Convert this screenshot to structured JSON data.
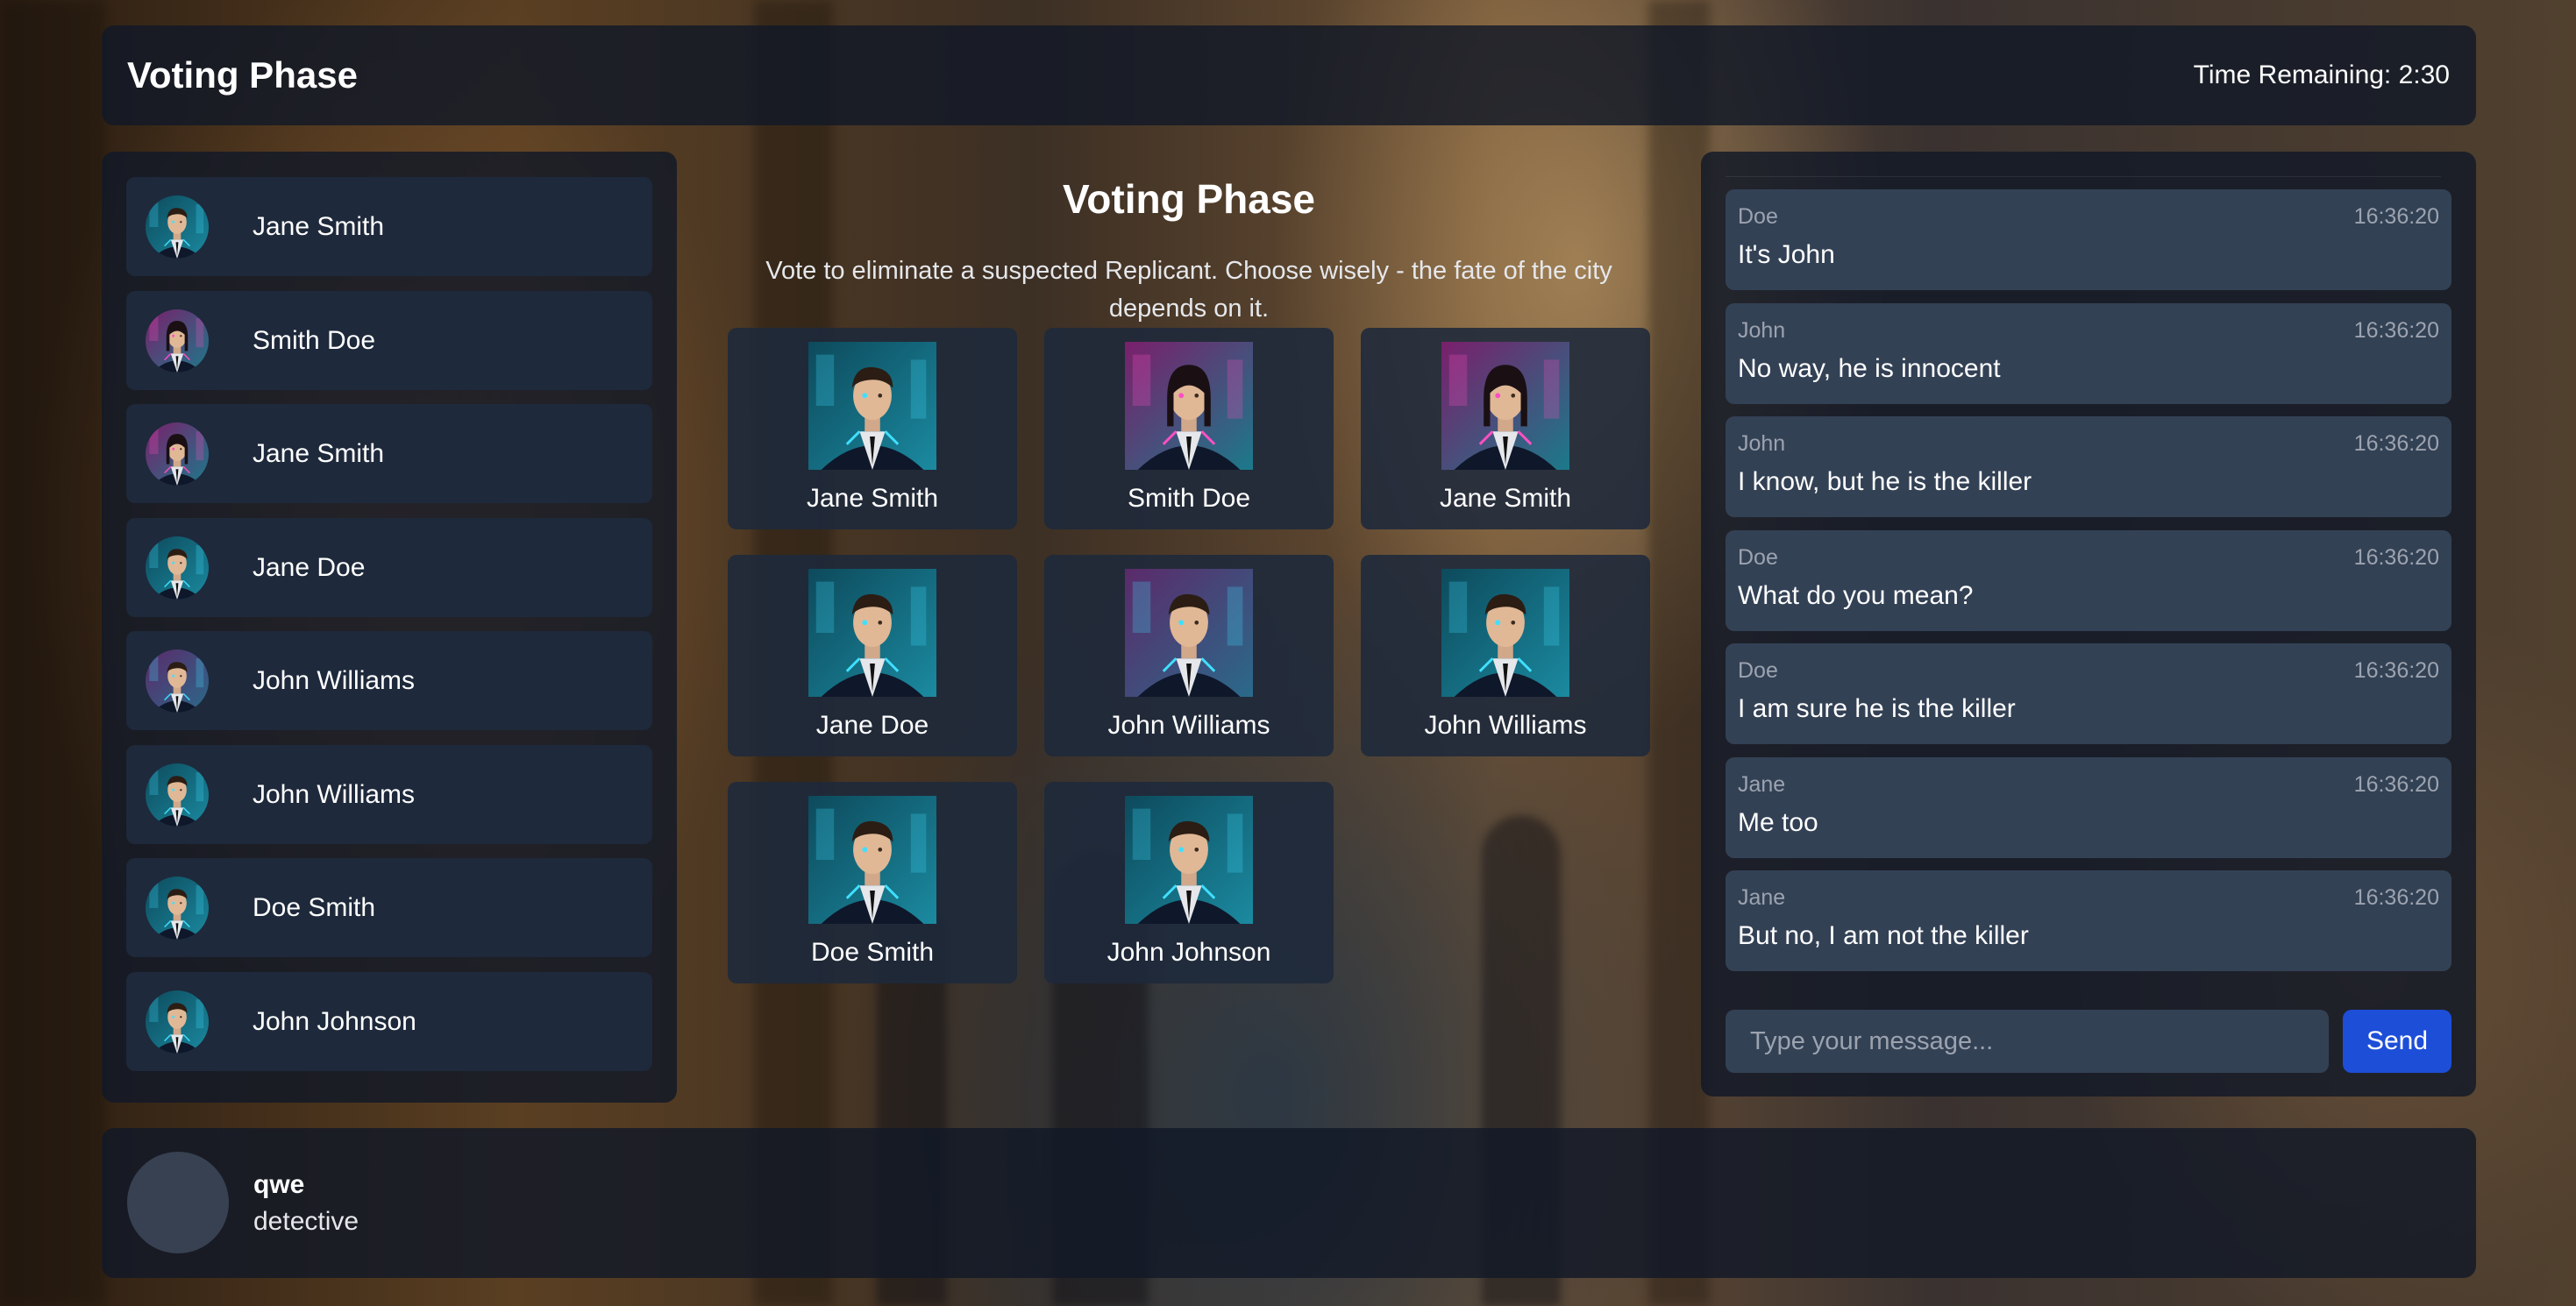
{
  "header": {
    "title": "Voting Phase",
    "timer": "Time Remaining: 2:30"
  },
  "players": [
    {
      "name": "Jane Smith",
      "avatar": "cyber-man-portrait"
    },
    {
      "name": "Smith Doe",
      "avatar": "cyber-woman-portrait"
    },
    {
      "name": "Jane Smith",
      "avatar": "cyber-woman-portrait"
    },
    {
      "name": "Jane Doe",
      "avatar": "cyber-man-portrait"
    },
    {
      "name": "John Williams",
      "avatar": "cyber-man-neon-portrait"
    },
    {
      "name": "John Williams",
      "avatar": "cyber-man-portrait"
    },
    {
      "name": "Doe Smith",
      "avatar": "cyber-man-portrait"
    },
    {
      "name": "John Johnson",
      "avatar": "cyber-man-portrait"
    }
  ],
  "voting": {
    "title": "Voting Phase",
    "description": "Vote to eliminate a suspected Replicant. Choose wisely - the fate of the city depends on it.",
    "candidates": [
      {
        "name": "Jane Smith",
        "avatar": "cyber-man-portrait"
      },
      {
        "name": "Smith Doe",
        "avatar": "cyber-woman-portrait"
      },
      {
        "name": "Jane Smith",
        "avatar": "cyber-woman-portrait"
      },
      {
        "name": "Jane Doe",
        "avatar": "cyber-man-portrait"
      },
      {
        "name": "John Williams",
        "avatar": "cyber-man-neon-portrait"
      },
      {
        "name": "John Williams",
        "avatar": "cyber-man-portrait"
      },
      {
        "name": "Doe Smith",
        "avatar": "cyber-man-portrait"
      },
      {
        "name": "John Johnson",
        "avatar": "cyber-man-portrait"
      }
    ]
  },
  "chat": {
    "messages": [
      {
        "sender": "Doe",
        "time": "16:36:20",
        "text": "It's John"
      },
      {
        "sender": "John",
        "time": "16:36:20",
        "text": "No way, he is innocent"
      },
      {
        "sender": "John",
        "time": "16:36:20",
        "text": "I know, but he is the killer"
      },
      {
        "sender": "Doe",
        "time": "16:36:20",
        "text": "What do you mean?"
      },
      {
        "sender": "Doe",
        "time": "16:36:20",
        "text": "I am sure he is the killer"
      },
      {
        "sender": "Jane",
        "time": "16:36:20",
        "text": "Me too"
      },
      {
        "sender": "Jane",
        "time": "16:36:20",
        "text": "But no, I am not the killer"
      }
    ],
    "input_placeholder": "Type your message...",
    "input_value": "",
    "send_label": "Send"
  },
  "user": {
    "name": "qwe",
    "role": "detective"
  },
  "colors": {
    "panel": "#111827",
    "card": "#1e293b",
    "message": "#334155",
    "accent": "#1d4ed8",
    "muted_text": "#9ca3af"
  }
}
